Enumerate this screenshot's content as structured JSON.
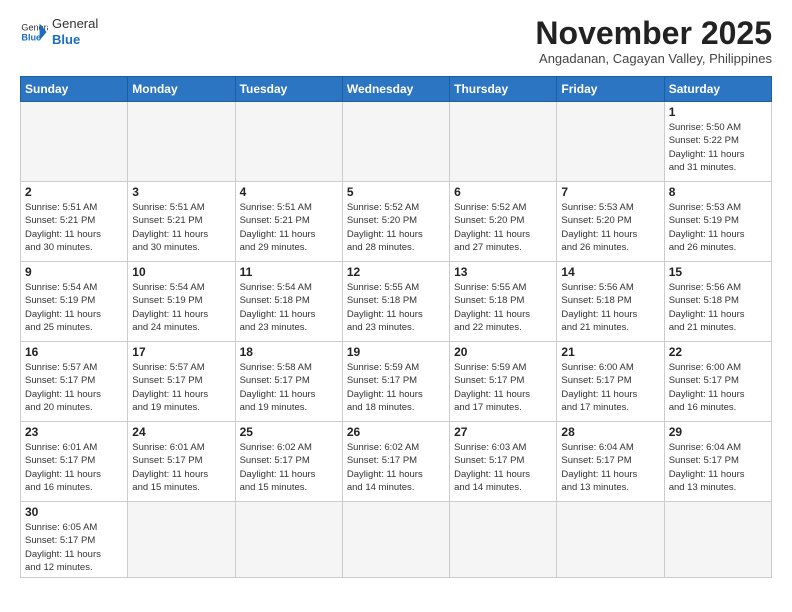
{
  "header": {
    "logo_general": "General",
    "logo_blue": "Blue",
    "month_title": "November 2025",
    "location": "Angadanan, Cagayan Valley, Philippines"
  },
  "weekdays": [
    "Sunday",
    "Monday",
    "Tuesday",
    "Wednesday",
    "Thursday",
    "Friday",
    "Saturday"
  ],
  "weeks": [
    [
      {
        "day": "",
        "info": ""
      },
      {
        "day": "",
        "info": ""
      },
      {
        "day": "",
        "info": ""
      },
      {
        "day": "",
        "info": ""
      },
      {
        "day": "",
        "info": ""
      },
      {
        "day": "",
        "info": ""
      },
      {
        "day": "1",
        "info": "Sunrise: 5:50 AM\nSunset: 5:22 PM\nDaylight: 11 hours\nand 31 minutes."
      }
    ],
    [
      {
        "day": "2",
        "info": "Sunrise: 5:51 AM\nSunset: 5:21 PM\nDaylight: 11 hours\nand 30 minutes."
      },
      {
        "day": "3",
        "info": "Sunrise: 5:51 AM\nSunset: 5:21 PM\nDaylight: 11 hours\nand 30 minutes."
      },
      {
        "day": "4",
        "info": "Sunrise: 5:51 AM\nSunset: 5:21 PM\nDaylight: 11 hours\nand 29 minutes."
      },
      {
        "day": "5",
        "info": "Sunrise: 5:52 AM\nSunset: 5:20 PM\nDaylight: 11 hours\nand 28 minutes."
      },
      {
        "day": "6",
        "info": "Sunrise: 5:52 AM\nSunset: 5:20 PM\nDaylight: 11 hours\nand 27 minutes."
      },
      {
        "day": "7",
        "info": "Sunrise: 5:53 AM\nSunset: 5:20 PM\nDaylight: 11 hours\nand 26 minutes."
      },
      {
        "day": "8",
        "info": "Sunrise: 5:53 AM\nSunset: 5:19 PM\nDaylight: 11 hours\nand 26 minutes."
      }
    ],
    [
      {
        "day": "9",
        "info": "Sunrise: 5:54 AM\nSunset: 5:19 PM\nDaylight: 11 hours\nand 25 minutes."
      },
      {
        "day": "10",
        "info": "Sunrise: 5:54 AM\nSunset: 5:19 PM\nDaylight: 11 hours\nand 24 minutes."
      },
      {
        "day": "11",
        "info": "Sunrise: 5:54 AM\nSunset: 5:18 PM\nDaylight: 11 hours\nand 23 minutes."
      },
      {
        "day": "12",
        "info": "Sunrise: 5:55 AM\nSunset: 5:18 PM\nDaylight: 11 hours\nand 23 minutes."
      },
      {
        "day": "13",
        "info": "Sunrise: 5:55 AM\nSunset: 5:18 PM\nDaylight: 11 hours\nand 22 minutes."
      },
      {
        "day": "14",
        "info": "Sunrise: 5:56 AM\nSunset: 5:18 PM\nDaylight: 11 hours\nand 21 minutes."
      },
      {
        "day": "15",
        "info": "Sunrise: 5:56 AM\nSunset: 5:18 PM\nDaylight: 11 hours\nand 21 minutes."
      }
    ],
    [
      {
        "day": "16",
        "info": "Sunrise: 5:57 AM\nSunset: 5:17 PM\nDaylight: 11 hours\nand 20 minutes."
      },
      {
        "day": "17",
        "info": "Sunrise: 5:57 AM\nSunset: 5:17 PM\nDaylight: 11 hours\nand 19 minutes."
      },
      {
        "day": "18",
        "info": "Sunrise: 5:58 AM\nSunset: 5:17 PM\nDaylight: 11 hours\nand 19 minutes."
      },
      {
        "day": "19",
        "info": "Sunrise: 5:59 AM\nSunset: 5:17 PM\nDaylight: 11 hours\nand 18 minutes."
      },
      {
        "day": "20",
        "info": "Sunrise: 5:59 AM\nSunset: 5:17 PM\nDaylight: 11 hours\nand 17 minutes."
      },
      {
        "day": "21",
        "info": "Sunrise: 6:00 AM\nSunset: 5:17 PM\nDaylight: 11 hours\nand 17 minutes."
      },
      {
        "day": "22",
        "info": "Sunrise: 6:00 AM\nSunset: 5:17 PM\nDaylight: 11 hours\nand 16 minutes."
      }
    ],
    [
      {
        "day": "23",
        "info": "Sunrise: 6:01 AM\nSunset: 5:17 PM\nDaylight: 11 hours\nand 16 minutes."
      },
      {
        "day": "24",
        "info": "Sunrise: 6:01 AM\nSunset: 5:17 PM\nDaylight: 11 hours\nand 15 minutes."
      },
      {
        "day": "25",
        "info": "Sunrise: 6:02 AM\nSunset: 5:17 PM\nDaylight: 11 hours\nand 15 minutes."
      },
      {
        "day": "26",
        "info": "Sunrise: 6:02 AM\nSunset: 5:17 PM\nDaylight: 11 hours\nand 14 minutes."
      },
      {
        "day": "27",
        "info": "Sunrise: 6:03 AM\nSunset: 5:17 PM\nDaylight: 11 hours\nand 14 minutes."
      },
      {
        "day": "28",
        "info": "Sunrise: 6:04 AM\nSunset: 5:17 PM\nDaylight: 11 hours\nand 13 minutes."
      },
      {
        "day": "29",
        "info": "Sunrise: 6:04 AM\nSunset: 5:17 PM\nDaylight: 11 hours\nand 13 minutes."
      }
    ],
    [
      {
        "day": "30",
        "info": "Sunrise: 6:05 AM\nSunset: 5:17 PM\nDaylight: 11 hours\nand 12 minutes."
      },
      {
        "day": "",
        "info": ""
      },
      {
        "day": "",
        "info": ""
      },
      {
        "day": "",
        "info": ""
      },
      {
        "day": "",
        "info": ""
      },
      {
        "day": "",
        "info": ""
      },
      {
        "day": "",
        "info": ""
      }
    ]
  ]
}
